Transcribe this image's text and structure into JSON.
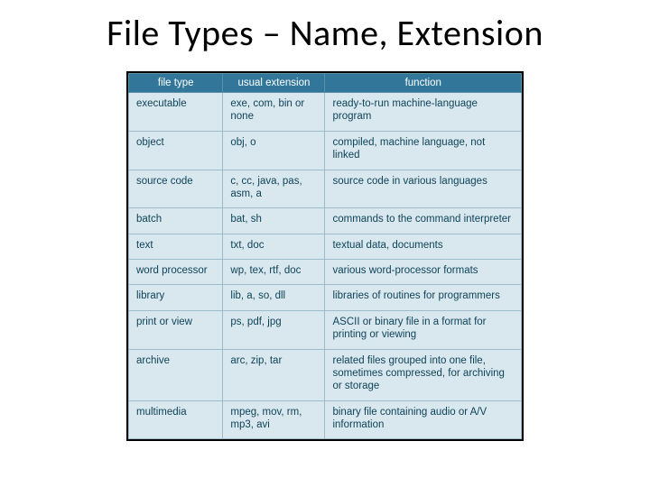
{
  "title": "File Types – Name, Extension",
  "headers": {
    "c0": "file type",
    "c1": "usual extension",
    "c2": "function"
  },
  "rows": [
    {
      "type": "executable",
      "ext": "exe, com, bin or none",
      "func": "ready-to-run machine-language program"
    },
    {
      "type": "object",
      "ext": "obj, o",
      "func": "compiled, machine language, not linked"
    },
    {
      "type": "source code",
      "ext": "c, cc, java, pas, asm, a",
      "func": "source code in various languages"
    },
    {
      "type": "batch",
      "ext": "bat, sh",
      "func": "commands to the command interpreter"
    },
    {
      "type": "text",
      "ext": "txt, doc",
      "func": "textual data, documents"
    },
    {
      "type": "word processor",
      "ext": "wp, tex, rtf, doc",
      "func": "various word-processor formats"
    },
    {
      "type": "library",
      "ext": "lib, a, so, dll",
      "func": "libraries of routines for programmers"
    },
    {
      "type": "print or view",
      "ext": "ps, pdf, jpg",
      "func": "ASCII or binary file in a format for printing or viewing"
    },
    {
      "type": "archive",
      "ext": "arc, zip, tar",
      "func": "related files grouped into one file, sometimes compressed, for archiving or storage"
    },
    {
      "type": "multimedia",
      "ext": "mpeg, mov, rm, mp3, avi",
      "func": "binary file containing audio or A/V information"
    }
  ]
}
